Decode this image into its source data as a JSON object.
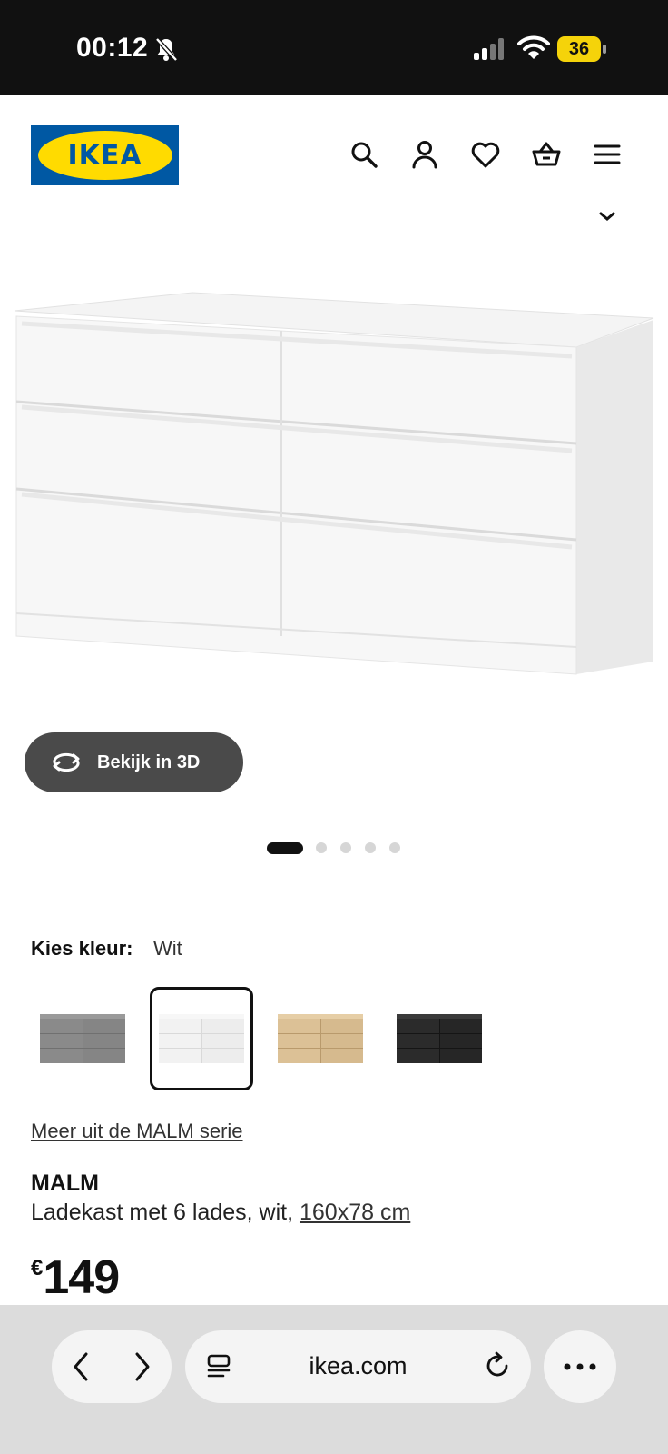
{
  "status_bar": {
    "time": "00:12",
    "battery": "36",
    "icons": [
      "bell-slash-icon",
      "cellular-signal-icon",
      "wifi-icon",
      "battery-icon"
    ]
  },
  "header": {
    "logo_text": "IKEA",
    "icons": [
      "search-icon",
      "account-icon",
      "wishlist-heart-icon",
      "basket-icon",
      "menu-icon"
    ],
    "brand_colors": {
      "blue": "#0058a3",
      "yellow": "#ffdb00"
    }
  },
  "gallery": {
    "view_3d_label": "Bekijk in 3D",
    "slide_count": 5,
    "active_slide": 1
  },
  "color_picker": {
    "label": "Kies kleur:",
    "selected": "Wit",
    "options": [
      {
        "name": "grijs",
        "color": "#8a8a8a"
      },
      {
        "name": "wit",
        "color": "#f2f2f2"
      },
      {
        "name": "eikenfineer",
        "color": "#dcc196"
      },
      {
        "name": "zwartbruin",
        "color": "#2b2b2b"
      }
    ]
  },
  "series_link": "Meer uit de MALM serie",
  "product": {
    "name": "MALM",
    "description": "Ladekast met 6 lades, wit, ",
    "size": "160x78 cm",
    "currency": "€",
    "price": "149"
  },
  "browser": {
    "url": "ikea.com"
  }
}
